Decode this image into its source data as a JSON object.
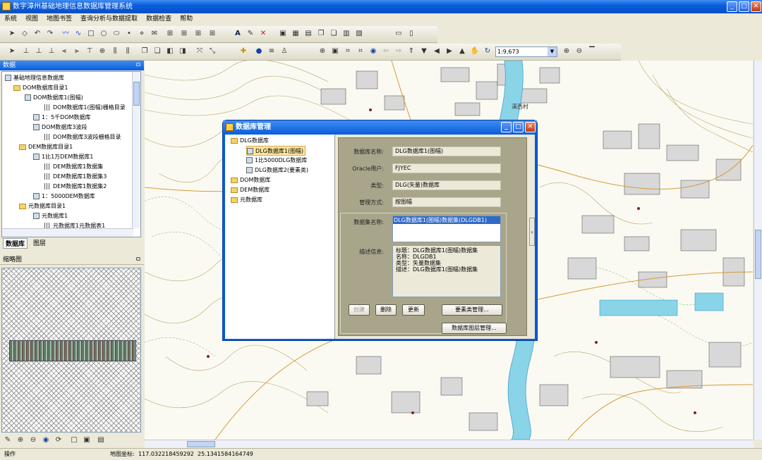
{
  "window": {
    "title": "数字漳州基础地理信息数据库管理系统"
  },
  "menu": [
    "系统",
    "视图",
    "地图书签",
    "查询分析与数据提取",
    "数据检查",
    "帮助"
  ],
  "toolbar": {
    "scale_value": "1:9,673"
  },
  "data_panel": {
    "title": "数据",
    "tree": [
      {
        "label": "基础地理信息数据库",
        "level": 0,
        "icon": "db"
      },
      {
        "label": "DOM数据库目录1",
        "level": 1,
        "icon": "folder"
      },
      {
        "label": "DOM数据库1(图幅)",
        "level": 2,
        "icon": "db"
      },
      {
        "label": "DOM数据库1(图幅)栅格目录",
        "level": 3,
        "icon": "grid"
      },
      {
        "label": "1：5千DOM数据库",
        "level": 2,
        "icon": "db"
      },
      {
        "label": "DOM数据库3波段",
        "level": 2,
        "icon": "db"
      },
      {
        "label": "DOM数据库3波段栅格目录",
        "level": 3,
        "icon": "grid"
      },
      {
        "label": "DEM数据库目录1",
        "level": 1,
        "icon": "folder"
      },
      {
        "label": "1比1万DEM数据库1",
        "level": 2,
        "icon": "db"
      },
      {
        "label": "DEM数据库1数据集",
        "level": 3,
        "icon": "grid"
      },
      {
        "label": "DEM数据库1数据集3",
        "level": 3,
        "icon": "grid"
      },
      {
        "label": "DEM数据库1数据集2",
        "level": 3,
        "icon": "grid"
      },
      {
        "label": "1：5000DEM数据库",
        "level": 2,
        "icon": "db"
      },
      {
        "label": "元数据库目录1",
        "level": 1,
        "icon": "folder"
      },
      {
        "label": "元数据库1",
        "level": 2,
        "icon": "db"
      },
      {
        "label": "元数据库1元数据表1",
        "level": 3,
        "icon": "grid"
      }
    ],
    "tabs": [
      "数据库",
      "图层"
    ]
  },
  "thumbnail": {
    "title": "缩略图"
  },
  "dialog": {
    "title": "数据库管理",
    "tree": [
      {
        "label": "DLG数据库",
        "level": 0
      },
      {
        "label": "DLG数据库1(图幅)",
        "level": 1,
        "selected": true
      },
      {
        "label": "1比5000DLG数据库",
        "level": 1
      },
      {
        "label": "DLG数据库2(要素类)",
        "level": 1
      },
      {
        "label": "DOM数据库",
        "level": 0
      },
      {
        "label": "DEM数据库",
        "level": 0
      },
      {
        "label": "元数据库",
        "level": 0
      }
    ],
    "fields": {
      "name_label": "数据库名称:",
      "name_value": "DLG数据库1(图幅)",
      "oracle_label": "Oracle用户:",
      "oracle_value": "FJYEC",
      "type_label": "类型:",
      "type_value": "DLG(矢量)数据库",
      "manage_label": "管理方式:",
      "manage_value": "按图幅",
      "dataset_label": "数据集名称:",
      "dataset_value": "DLG数据库1(图幅)数据集(DLGDB1)",
      "desc_label": "描述信息:",
      "desc_lines": [
        "标题：DLG数据库1(图幅)数据集",
        "名称：DLGDB1",
        "类型：矢量数据集",
        "描述：DLG数据库1(图幅)数据集"
      ]
    },
    "buttons": {
      "create": "创建",
      "delete": "删除",
      "update": "更新",
      "feature_mgmt": "要素类管理...",
      "layer_mgmt": "数据库图层管理..."
    }
  },
  "map_label": "溪西村",
  "status": {
    "mode": "操作",
    "coord_label": "地图坐标:",
    "coord_value": "117.032218459292  25.1341584164749"
  }
}
